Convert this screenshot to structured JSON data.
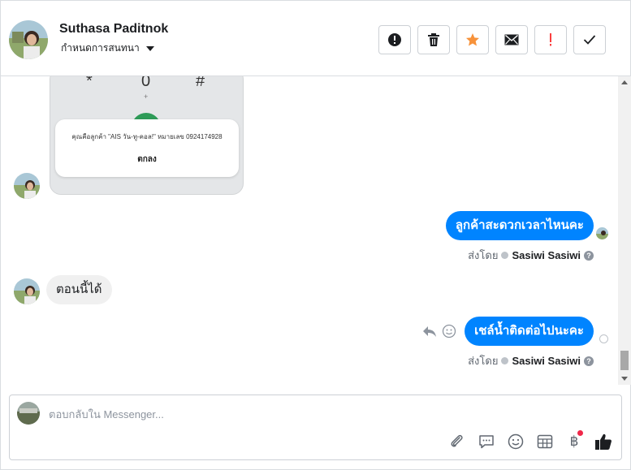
{
  "header": {
    "contact_name": "Suthasa Paditnok",
    "conversation_action": "กำหนดการสนทนา",
    "toolbar": {
      "icons": [
        "alert-circle-icon",
        "trash-icon",
        "star-icon",
        "envelope-icon",
        "exclamation-icon",
        "check-icon"
      ],
      "star_color": "#f7923a",
      "exclamation_color": "#fa3e3e"
    }
  },
  "chat": {
    "attachment": {
      "keypad_keys": [
        "*",
        "0",
        "#"
      ],
      "plus_label": "+",
      "dialog_text": "คุณคือลูกค้า \"AIS วัน-ทู-คอล!\" หมายเลข 0924174928",
      "dialog_ok": "ตกลง"
    },
    "messages": [
      {
        "direction": "out",
        "text": "ลูกค้าสะดวกเวลาไหนคะ",
        "sent_by_prefix": "ส่งโดย",
        "sender": "Sasiwi Sasiwi"
      },
      {
        "direction": "in",
        "text": "ตอนนี้ได้"
      },
      {
        "direction": "out",
        "text": "เชล์น้ำติดต่อไปนะคะ",
        "sent_by_prefix": "ส่งโดย",
        "sender": "Sasiwi Sasiwi"
      }
    ],
    "help_glyph": "?",
    "accent_color": "#0084ff"
  },
  "composer": {
    "placeholder": "ตอบกลับใน Messenger...",
    "tools": [
      "paperclip-icon",
      "chat-bubble-icon",
      "smiley-icon",
      "table-icon",
      "baht-icon",
      "thumbs-up-icon"
    ],
    "baht_symbol": "฿",
    "notification_dot_color": "#f02849"
  }
}
